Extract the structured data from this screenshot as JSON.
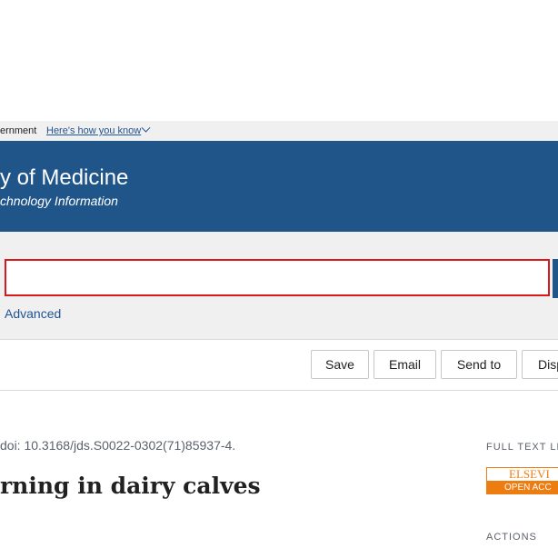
{
  "gov_banner": {
    "text": "ernment",
    "link": "Here's how you know"
  },
  "header": {
    "title": "y of Medicine",
    "subtitle": "chnology Information"
  },
  "search": {
    "value": "",
    "placeholder": "",
    "advanced_label": "Advanced"
  },
  "toolbar": {
    "save_label": "Save",
    "email_label": "Email",
    "send_label": "Send to",
    "display_label": "Disp"
  },
  "article": {
    "doi": "doi: 10.3168/jds.S0022-0302(71)85937-4.",
    "title": "rning in dairy calves"
  },
  "sidebar": {
    "full_text_heading": "FULL TEXT LIN",
    "elsevier_top": "ELSEVI",
    "elsevier_bottom": "OPEN ACC",
    "actions_heading": "ACTIONS"
  },
  "colors": {
    "header_bg": "#20558a",
    "link": "#205493",
    "search_border": "#d7191c",
    "elsevier_orange": "#ee7d11"
  }
}
